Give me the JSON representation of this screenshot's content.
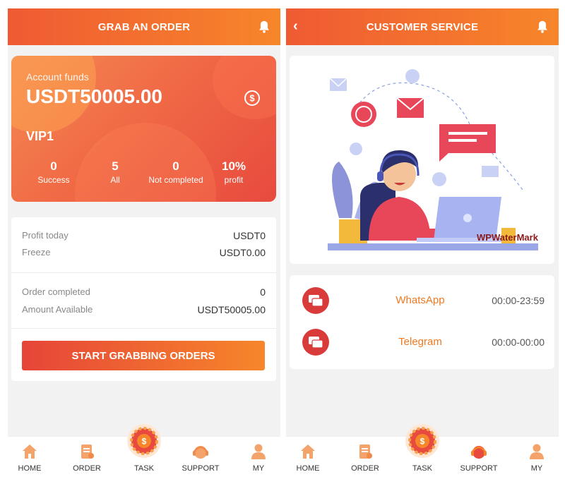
{
  "left_screen": {
    "title": "GRAB AN ORDER",
    "account": {
      "label": "Account funds",
      "amount": "USDT50005.00",
      "vip": "VIP1",
      "stats": [
        {
          "value": "0",
          "label": "Success"
        },
        {
          "value": "5",
          "label": "All"
        },
        {
          "value": "0",
          "label": "Not completed"
        },
        {
          "value": "10%",
          "label": "profit"
        }
      ]
    },
    "info": [
      {
        "key": "Profit today",
        "value": "USDT0"
      },
      {
        "key": "Freeze",
        "value": "USDT0.00"
      },
      {
        "key": "Order completed",
        "value": "0"
      },
      {
        "key": "Amount Available",
        "value": "USDT50005.00"
      }
    ],
    "start_button": "START GRABBING ORDERS"
  },
  "right_screen": {
    "title": "CUSTOMER SERVICE",
    "back_icon": "‹",
    "watermark": "WPWaterMark",
    "contacts": [
      {
        "name": "WhatsApp",
        "hours": "00:00-23:59"
      },
      {
        "name": "Telegram",
        "hours": "00:00-00:00"
      }
    ]
  },
  "nav": [
    {
      "label": "HOME",
      "icon": "home-icon"
    },
    {
      "label": "ORDER",
      "icon": "order-icon"
    },
    {
      "label": "TASK",
      "icon": "task-icon"
    },
    {
      "label": "SUPPORT",
      "icon": "support-icon"
    },
    {
      "label": "MY",
      "icon": "user-icon"
    }
  ],
  "colors": {
    "accent": "#f07a22",
    "accent_red": "#e64538",
    "icon_orange": "#f4a46a"
  }
}
